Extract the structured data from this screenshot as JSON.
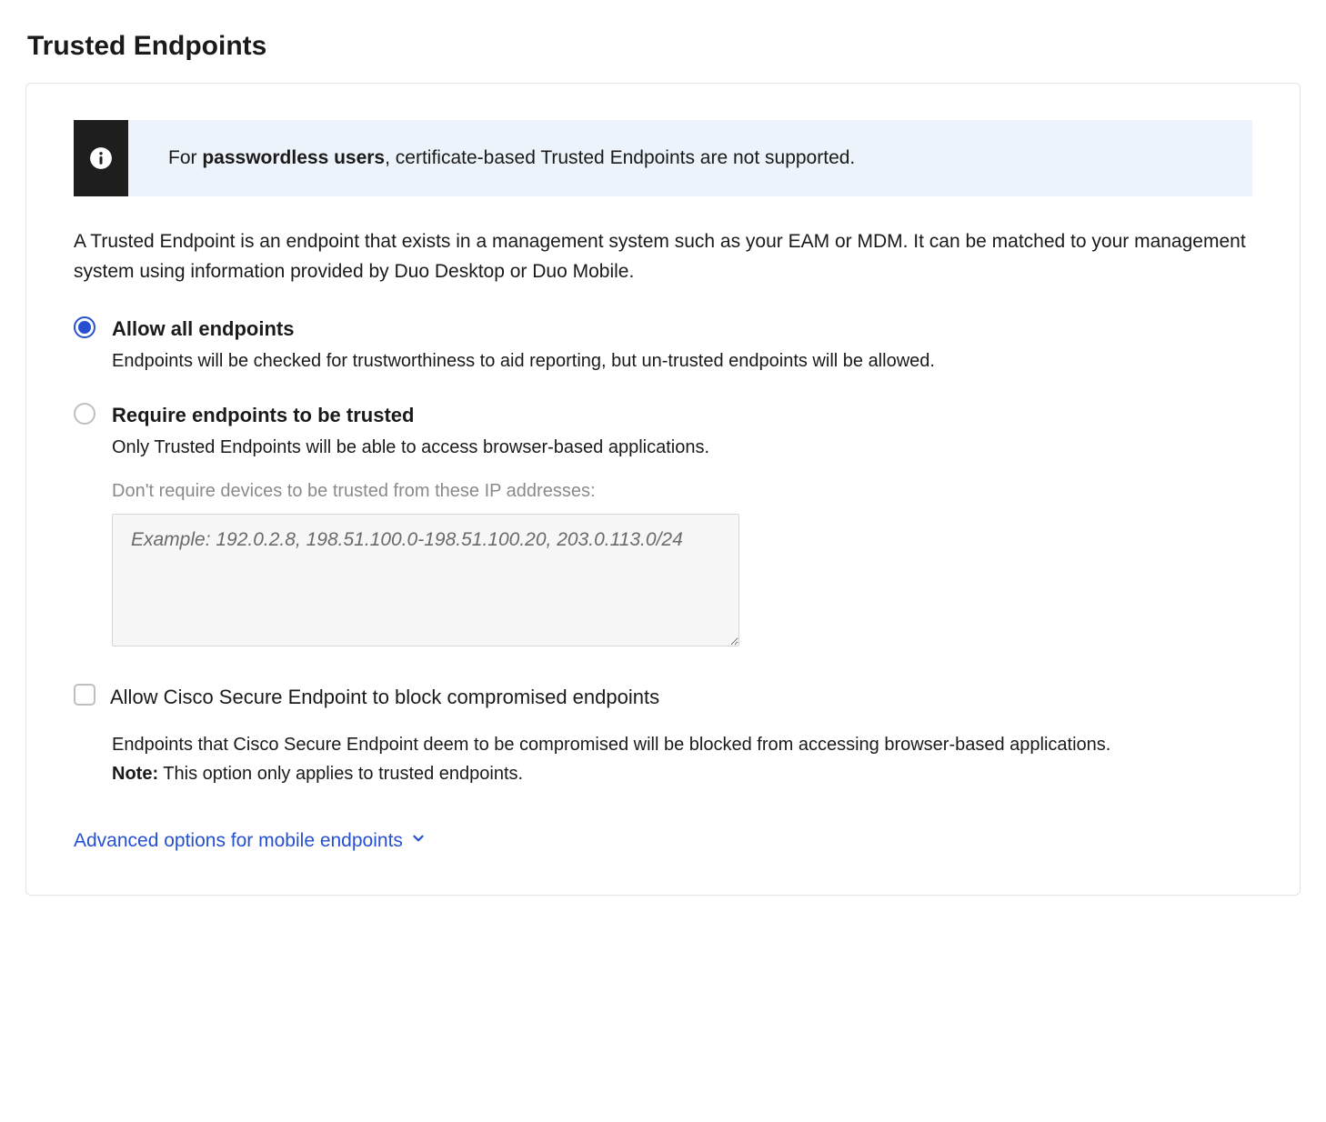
{
  "title": "Trusted Endpoints",
  "info_banner": {
    "prefix": "For ",
    "bold": "passwordless users",
    "suffix": ", certificate-based Trusted Endpoints are not supported."
  },
  "description": "A Trusted Endpoint is an endpoint that exists in a management system such as your EAM or MDM. It can be matched to your management system using information provided by Duo Desktop or Duo Mobile.",
  "options": {
    "allow_all": {
      "label": "Allow all endpoints",
      "sub": "Endpoints will be checked for trustworthiness to aid reporting, but un-trusted endpoints will be allowed.",
      "selected": true
    },
    "require_trusted": {
      "label": "Require endpoints to be trusted",
      "sub": "Only Trusted Endpoints will be able to access browser-based applications.",
      "selected": false
    }
  },
  "ip_exempt": {
    "label": "Don't require devices to be trusted from these IP addresses:",
    "placeholder": "Example: 192.0.2.8, 198.51.100.0-198.51.100.20, 203.0.113.0/24",
    "value": ""
  },
  "cisco_block": {
    "label": "Allow Cisco Secure Endpoint to block compromised endpoints",
    "sub": "Endpoints that Cisco Secure Endpoint deem to be compromised will be blocked from accessing browser-based applications.",
    "note_label": "Note:",
    "note_text": " This option only applies to trusted endpoints.",
    "checked": false
  },
  "advanced_link": "Advanced options for mobile endpoints",
  "colors": {
    "accent": "#2550d2",
    "banner_bg": "#ecf3fb",
    "muted": "#8a8a8a"
  }
}
